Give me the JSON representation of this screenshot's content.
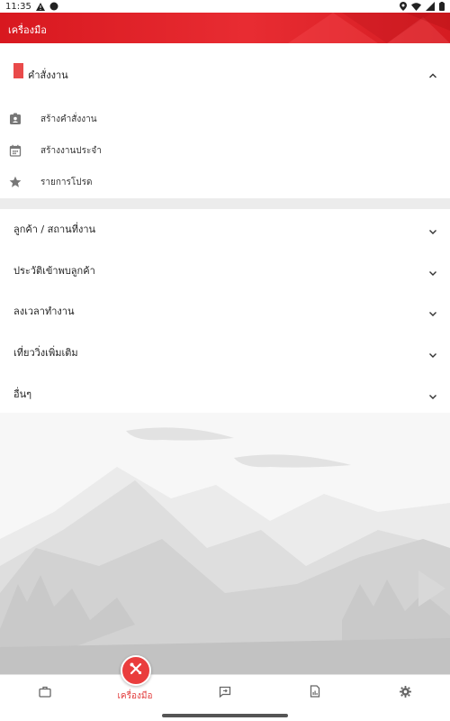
{
  "status_bar": {
    "time": "11:35",
    "icons": [
      "warning-icon",
      "circle-icon",
      "location-icon",
      "wifi-icon",
      "signal-icon",
      "battery-icon"
    ]
  },
  "app_bar": {
    "title": "เครื่องมือ",
    "color": "#e0252b"
  },
  "work_order_section": {
    "title": "คำสั่งงาน",
    "expanded": true,
    "marker_color": "#e94a4a",
    "items": [
      {
        "label": "สร้างคำสั่งงาน",
        "icon": "id-badge-icon"
      },
      {
        "label": "สร้างงานประจำ",
        "icon": "calendar-icon"
      },
      {
        "label": "รายการโปรด",
        "icon": "star-icon"
      }
    ]
  },
  "accordion": [
    {
      "label": "ลูกค้า / สถานที่งาน"
    },
    {
      "label": "ประวัติเข้าพบลูกค้า"
    },
    {
      "label": "ลงเวลาทำงาน"
    },
    {
      "label": "เที่ยววิ่งเพิ่มเติม"
    },
    {
      "label": "อื่นๆ"
    }
  ],
  "bottom_nav": {
    "active_label": "เครื่องมือ",
    "accent": "#ea3d3d",
    "items": [
      "briefcase-icon",
      "tools-icon",
      "message-icon",
      "report-icon",
      "gear-icon"
    ]
  }
}
